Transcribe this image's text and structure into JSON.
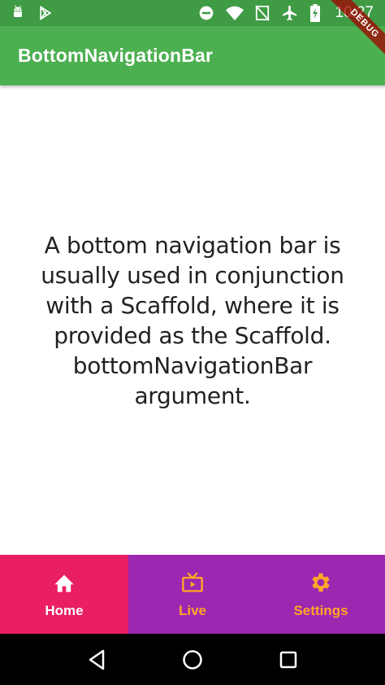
{
  "status_bar": {
    "time": "10:27",
    "left_icons": [
      "android-icon",
      "play-store-icon"
    ],
    "right_icons": [
      "do-not-disturb-icon",
      "wifi-icon",
      "no-sim-icon",
      "airplane-mode-icon",
      "battery-charging-icon"
    ],
    "color": "#3f9b44"
  },
  "app_bar": {
    "title": "BottomNavigationBar",
    "color": "#4caf50"
  },
  "debug_banner": {
    "label": "DEBUG"
  },
  "main": {
    "text": "A bottom navigation bar is usually used in conjunction with a Scaffold, where it is provided as the Scaffold. bottomNavigationBar argument."
  },
  "bottom_nav": {
    "background": "#9c27b0",
    "active_background": "#e91e63",
    "active_color": "#ffffff",
    "inactive_color": "#ffa726",
    "items": [
      {
        "label": "Home",
        "icon": "home-icon",
        "active": true
      },
      {
        "label": "Live",
        "icon": "live-tv-icon",
        "active": false
      },
      {
        "label": "Settings",
        "icon": "settings-icon",
        "active": false
      }
    ]
  },
  "system_nav": {
    "buttons": [
      "back-icon",
      "home-circle-icon",
      "recents-icon"
    ]
  }
}
